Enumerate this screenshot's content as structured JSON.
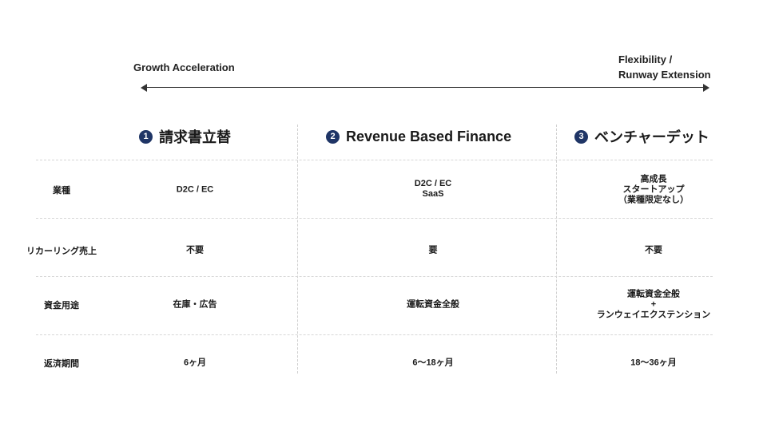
{
  "axis": {
    "left_label": "Growth Acceleration",
    "right_label_line1": "Flexibility /",
    "right_label_line2": "Runway Extension"
  },
  "columns": [
    {
      "number": "1",
      "title": "請求書立替"
    },
    {
      "number": "2",
      "title": "Revenue Based Finance"
    },
    {
      "number": "3",
      "title": "ベンチャーデット"
    }
  ],
  "rows": [
    {
      "label": "業種",
      "cells": [
        [
          "D2C / EC"
        ],
        [
          "D2C / EC",
          "SaaS"
        ],
        [
          "高成長",
          "スタートアップ",
          "（業種限定なし）"
        ]
      ]
    },
    {
      "label": "リカーリング売上",
      "cells": [
        [
          "不要"
        ],
        [
          "要"
        ],
        [
          "不要"
        ]
      ]
    },
    {
      "label": "資金用途",
      "cells": [
        [
          "在庫・広告"
        ],
        [
          "運転資金全般"
        ],
        [
          "運転資金全般",
          "+",
          "ランウェイエクステンション"
        ]
      ]
    },
    {
      "label": "返済期間",
      "cells": [
        [
          "6ヶ月"
        ],
        [
          "6〜18ヶ月"
        ],
        [
          "18〜36ヶ月"
        ]
      ]
    }
  ],
  "colors": {
    "badge": "#1f3566",
    "divider": "#cfcfcf",
    "arrow": "#333333"
  }
}
